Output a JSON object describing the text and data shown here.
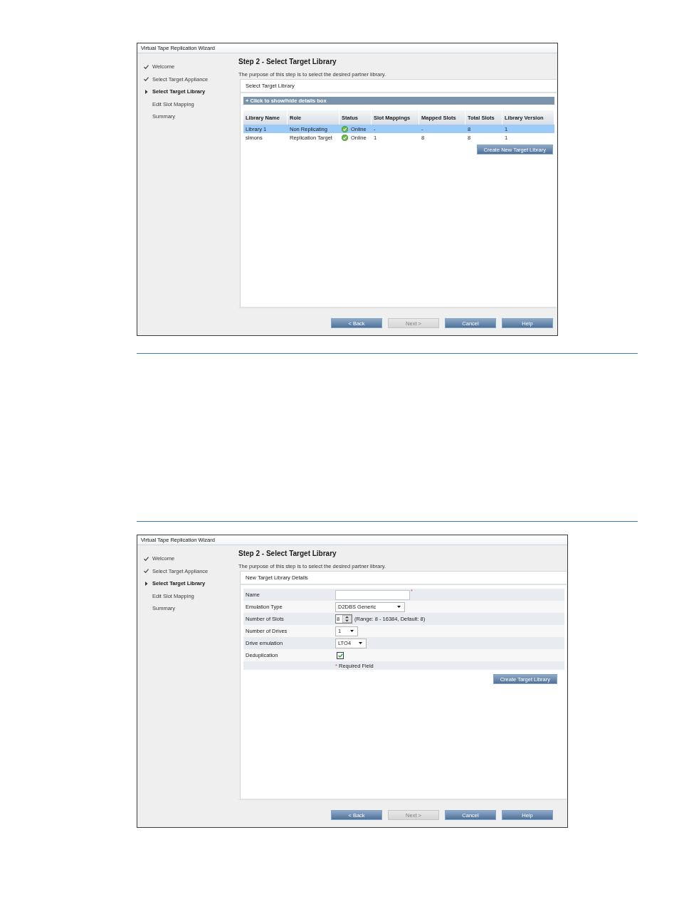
{
  "wizards": [
    {
      "title": "Virtual Tape Replication Wizard",
      "steps": [
        {
          "label": "Welcome",
          "completed": true,
          "selected": false
        },
        {
          "label": "Select Target Appliance",
          "completed": true,
          "selected": false
        },
        {
          "label": "Select Target Library",
          "completed": false,
          "selected": true
        },
        {
          "label": "Edit Slot Mapping",
          "completed": false,
          "selected": false
        },
        {
          "label": "Summary",
          "completed": false,
          "selected": false
        }
      ],
      "heading": "Step 2 - Select Target Library",
      "description": "The purpose of this step is to select the desired partner library.",
      "panel": {
        "kind": "library_table",
        "title": "Select Target Library",
        "details_toggle": "+ Click to show/hide details box",
        "table": {
          "columns": [
            {
              "label": "Library Name",
              "kind": "text"
            },
            {
              "label": "Role",
              "kind": "text"
            },
            {
              "label": "Status",
              "kind": "status"
            },
            {
              "label": "Slot Mappings",
              "kind": "text"
            },
            {
              "label": "Mapped Slots",
              "kind": "text"
            },
            {
              "label": "Total Slots",
              "kind": "text"
            },
            {
              "label": "Library Version",
              "kind": "text"
            }
          ],
          "rows": [
            {
              "selected": true,
              "cells": [
                "Library 1",
                "Non Replicating",
                "Online",
                "-",
                "-",
                "8",
                "1"
              ]
            },
            {
              "selected": false,
              "cells": [
                "simons",
                "Replication Target",
                "Online",
                "1",
                "8",
                "8",
                "1"
              ]
            }
          ]
        },
        "action_button": "Create New Target Library"
      },
      "buttons": [
        {
          "label": "< Back",
          "disabled": false
        },
        {
          "label": "Next >",
          "disabled": true
        },
        {
          "label": "Cancel",
          "disabled": false
        },
        {
          "label": "Help",
          "disabled": false
        }
      ]
    },
    {
      "title": "Virtual Tape Replication Wizard",
      "steps": [
        {
          "label": "Welcome",
          "completed": true,
          "selected": false
        },
        {
          "label": "Select Target Appliance",
          "completed": true,
          "selected": false
        },
        {
          "label": "Select Target Library",
          "completed": false,
          "selected": true
        },
        {
          "label": "Edit Slot Mapping",
          "completed": false,
          "selected": false
        },
        {
          "label": "Summary",
          "completed": false,
          "selected": false
        }
      ],
      "heading": "Step 2 - Select Target Library",
      "description": "The purpose of this step is to select the desired partner library.",
      "panel": {
        "kind": "library_form",
        "title": "New Target Library Details",
        "fields": [
          {
            "kind": "text",
            "label": "Name",
            "required_mark": "*"
          },
          {
            "kind": "select",
            "label": "Emulation Type",
            "value": "D2DBS Generic"
          },
          {
            "kind": "spinner",
            "label": "Number of Slots",
            "value": "8",
            "hint": "(Range: 8 - 16384, Default: 8)"
          },
          {
            "kind": "select",
            "label": "Number of Drives",
            "value": "1"
          },
          {
            "kind": "select",
            "label": "Drive emulation",
            "value": "LTO4"
          },
          {
            "kind": "checkbox",
            "label": "Deduplication",
            "checked": true
          },
          {
            "kind": "note",
            "mark": "*",
            "text": "Required Field"
          }
        ],
        "action_button": "Create Target Library"
      },
      "buttons": [
        {
          "label": "< Back",
          "disabled": false
        },
        {
          "label": "Next >",
          "disabled": true
        },
        {
          "label": "Cancel",
          "disabled": false
        },
        {
          "label": "Help",
          "disabled": false
        }
      ]
    }
  ]
}
